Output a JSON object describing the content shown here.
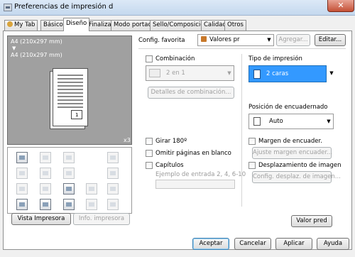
{
  "window": {
    "title": "Preferencias de impresión d"
  },
  "tabs": [
    "My Tab",
    "Básico",
    "Diseño",
    "Finalizar",
    "Modo portada",
    "Sello/Composición",
    "Calidad",
    "Otros"
  ],
  "preview": {
    "paper_line1": "A4 (210x297 mm)",
    "arrow": "▼",
    "paper_line2": "A4 (210x297 mm)",
    "page_number": "1",
    "copies": "x3"
  },
  "preview_buttons": {
    "vista": "Vista Impresora",
    "info": "Info. impresora"
  },
  "favorite": {
    "label": "Config. favorita",
    "value": "Valores pr",
    "add": "Agregar...",
    "edit": "Editar..."
  },
  "combination": {
    "label": "Combinación",
    "value": "2 en 1",
    "details": "Detalles de combinación..."
  },
  "options": {
    "rotate": "Girar 180º",
    "skip_blank": "Omitir páginas en blanco",
    "chapters": "Capítulos",
    "example_label": "Ejemplo de entrada 2, 4, 6-10"
  },
  "print_type": {
    "label": "Tipo de impresión",
    "value": "2 caras"
  },
  "binding": {
    "label": "Posición de encuadernado",
    "value": "Auto"
  },
  "margin": {
    "label": "Margen de encuader.",
    "button": "Ajuste margen encuader..."
  },
  "shift": {
    "label": "Desplazamiento de imagen",
    "button": "Config. desplaz. de imagen..."
  },
  "default_button": "Valor pred",
  "footer": {
    "ok": "Aceptar",
    "cancel": "Cancelar",
    "apply": "Aplicar",
    "help": "Ayuda"
  },
  "icons": {
    "grid": [
      "combine-icon",
      "staple-icon",
      "hole-icon",
      "booklet-icon",
      "copy-icon",
      "page-icon",
      "duplex-icon",
      "fold-icon",
      "stamp-icon",
      "watermark-icon",
      "overlay-icon",
      "header-icon",
      "user-icon",
      "account-icon",
      "settings-icon",
      "tray-icon"
    ]
  }
}
